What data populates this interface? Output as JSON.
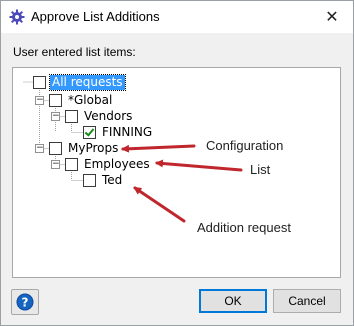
{
  "window": {
    "title": "Approve List Additions",
    "close_glyph": "✕"
  },
  "list_label": "User entered list items:",
  "tree": [
    {
      "label": "All requests",
      "checked": false,
      "selected": true,
      "expander": "−"
    },
    {
      "label": "*Global",
      "checked": false,
      "expander": "−"
    },
    {
      "label": "Vendors",
      "checked": false,
      "expander": "−"
    },
    {
      "label": "FINNING",
      "checked": true
    },
    {
      "label": "MyProps",
      "checked": false,
      "expander": "−"
    },
    {
      "label": "Employees",
      "checked": false,
      "expander": "−"
    },
    {
      "label": "Ted",
      "checked": false
    }
  ],
  "annotations": {
    "configuration": "Configuration",
    "list": "List",
    "addition_request": "Addition request"
  },
  "buttons": {
    "ok": "OK",
    "cancel": "Cancel",
    "help_glyph": "?"
  },
  "colors": {
    "arrow": "#c0272d",
    "selection": "#3399ff",
    "check": "#1a8b1a",
    "help": "#1565c0"
  },
  "icons": {
    "app": "gear-icon",
    "help": "help-icon"
  }
}
